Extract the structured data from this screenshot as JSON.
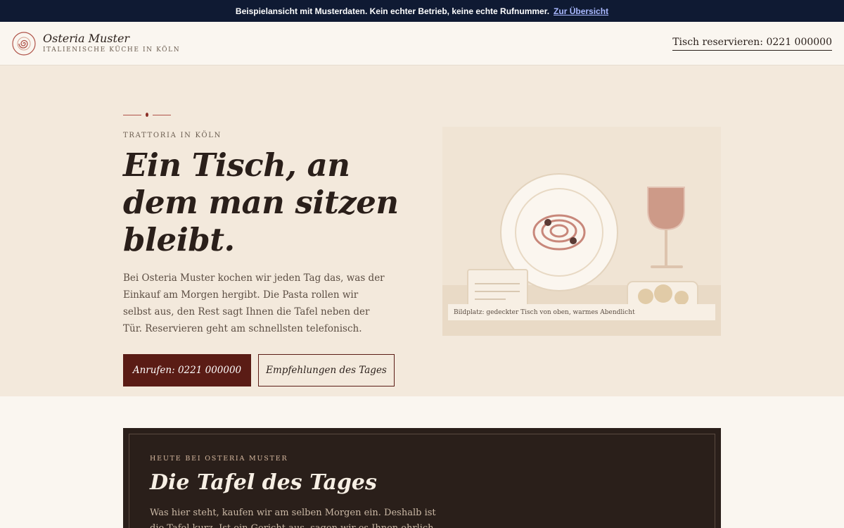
{
  "banner": {
    "text": "Beispielansicht mit Musterdaten. Kein echter Betrieb, keine echte Rufnummer.",
    "link": "Zur Übersicht"
  },
  "header": {
    "brand_name": "Osteria Muster",
    "brand_sub": "ITALIENISCHE KÜCHE IN KÖLN",
    "reserve": "Tisch reservieren: 0221 000000"
  },
  "hero": {
    "eyebrow": "TRATTORIA IN KÖLN",
    "headline": "Ein Tisch, an dem man sitzen bleibt.",
    "lead": "Bei Osteria Muster kochen wir jeden Tag das, was der Einkauf am Morgen hergibt. Die Pasta rollen wir selbst aus, den Rest sagt Ihnen die Tafel neben der Tür. Reservieren geht am schnellsten telefonisch.",
    "primary_button": "Anrufen: 0221 000000",
    "secondary_button": "Empfehlungen des Tages",
    "image_caption": "Bildplatz: gedeckter Tisch von oben, warmes Abendlicht"
  },
  "daily": {
    "eyebrow": "HEUTE BEI OSTERIA MUSTER",
    "title": "Die Tafel des Tages",
    "text": "Was hier steht, kaufen wir am selben Morgen ein. Deshalb ist die Tafel kurz. Ist ein Gericht aus, sagen wir es Ihnen ehrlich am Tisch."
  },
  "colors": {
    "accent": "#5a1c15",
    "banner_bg": "#0f1a33",
    "hero_bg": "#f3e9dc",
    "card_bg": "#2a1f1a"
  },
  "icons": {
    "logo": "spiral-logo-icon"
  }
}
